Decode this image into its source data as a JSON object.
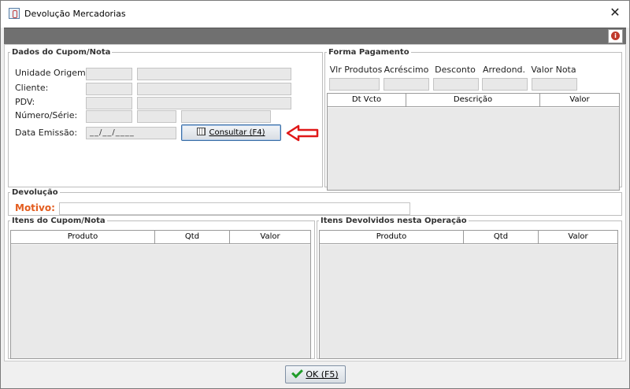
{
  "window": {
    "title": "Devolução Mercadorias",
    "close_glyph": "✕",
    "info_glyph": "i"
  },
  "dados": {
    "legend": "Dados do Cupom/Nota",
    "unidade_label": "Unidade Origem:",
    "cliente_label": "Cliente:",
    "pdv_label": "PDV:",
    "numero_label": "Número/Série:",
    "data_label": "Data Emissão:",
    "data_value": "__/__/____",
    "consultar_label": "Consultar (F4)"
  },
  "pagamento": {
    "legend": "Forma Pagamento",
    "totals_labels": [
      "Vlr Produtos",
      "Acréscimo",
      "Desconto",
      "Arredond.",
      "Valor Nota"
    ],
    "table_columns": [
      "Dt Vcto",
      "Descrição",
      "Valor"
    ]
  },
  "devolucao": {
    "legend": "Devolução",
    "motivo_label": "Motivo:"
  },
  "itens_cupom": {
    "legend": "Itens do Cupom/Nota",
    "columns": [
      "Produto",
      "Qtd",
      "Valor"
    ]
  },
  "itens_devolvidos": {
    "legend": "Itens Devolvidos nesta Operação",
    "columns": [
      "Produto",
      "Qtd",
      "Valor"
    ]
  },
  "footer": {
    "ok_label": "OK (F5)"
  },
  "colors": {
    "accent_arrow": "#e01818",
    "motivo_color": "#e35d1f",
    "ok_check": "#1f9c2a"
  },
  "icons": [
    "app-java-icon",
    "close-icon",
    "info-icon",
    "calendar-icon",
    "red-arrow-left-icon",
    "check-icon"
  ]
}
